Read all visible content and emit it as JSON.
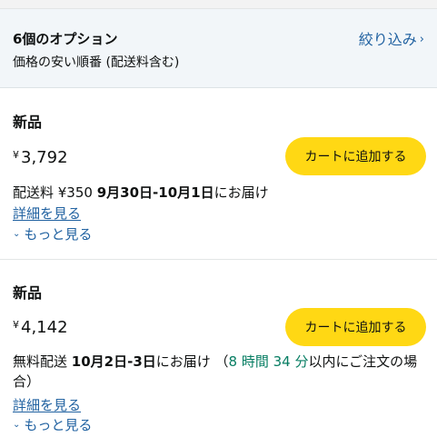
{
  "header": {
    "title": "6個のオプション",
    "subtitle": "価格の安い順番 (配送料含む)",
    "filter_label": "絞り込み",
    "filter_icon": "chevron-right-icon"
  },
  "offers": [
    {
      "condition": "新品",
      "currency": "¥",
      "price": "3,792",
      "cart_label": "カートに追加する",
      "delivery_prefix": "配送料 ¥350 ",
      "delivery_dates": "9月30日-10月1日",
      "delivery_suffix": "にお届け",
      "details_label": "詳細を見る",
      "more_label": "もっと見る"
    },
    {
      "condition": "新品",
      "currency": "¥",
      "price": "4,142",
      "cart_label": "カートに追加する",
      "delivery_prefix": "無料配送 ",
      "delivery_dates": "10月2日-3日",
      "delivery_suffix": "にお届け （",
      "countdown": "8 時間 34 分",
      "countdown_suffix": "以内にご注文の場合）",
      "details_label": "詳細を見る",
      "more_label": "もっと見る"
    }
  ],
  "colors": {
    "link": "#2162a1",
    "button": "#ffd814",
    "header_bg": "#f2f6f9",
    "countdown": "#067d62"
  }
}
